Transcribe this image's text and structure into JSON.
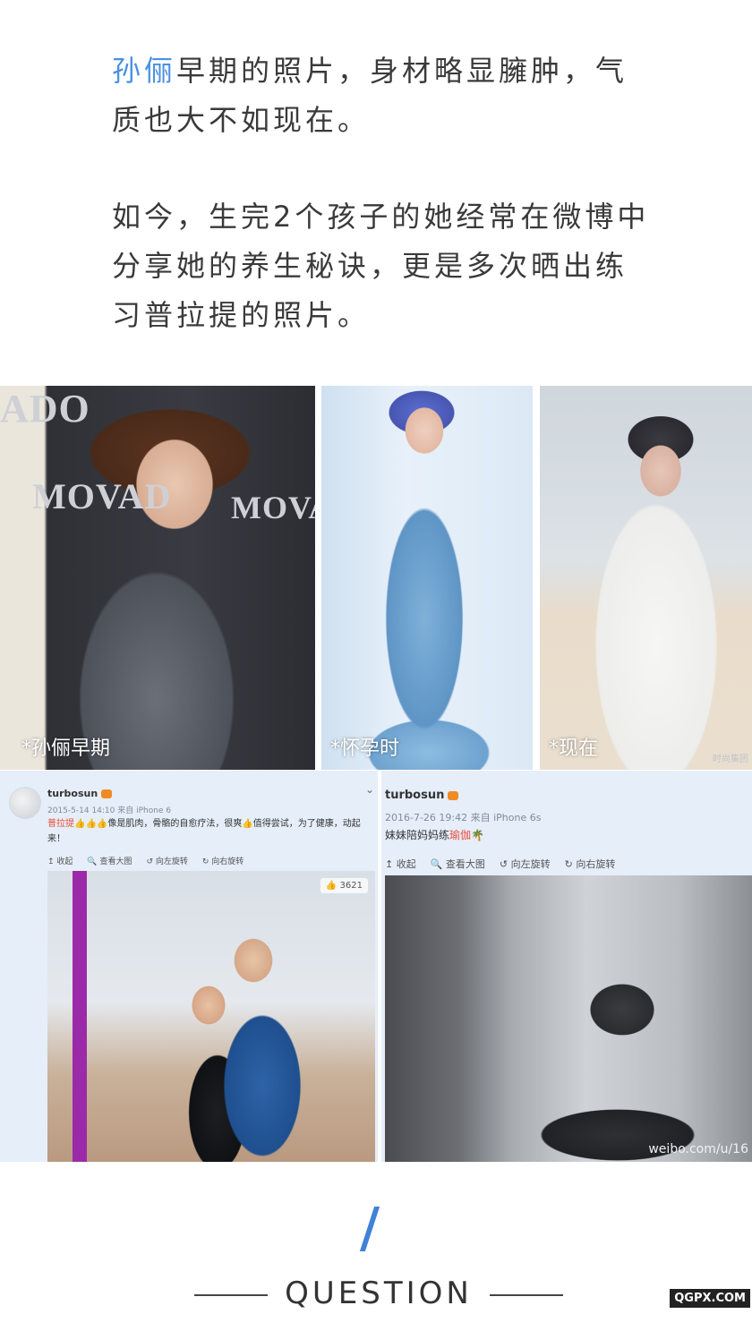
{
  "intro": {
    "name_highlight": "孙俪",
    "paragraph1_rest": "早期的照片，身材略显臃肿，气质也大不如现在。",
    "paragraph2": "如今，生完2个孩子的她经常在微博中分享她的养生秘诀，更是多次晒出练习普拉提的照片。"
  },
  "photos": [
    {
      "caption": "*孙俪早期",
      "brand_text_1": "MOVAD",
      "brand_text_2": "MOVAD",
      "brand_text_top": "ADO"
    },
    {
      "caption": "*怀孕时"
    },
    {
      "caption": "*现在",
      "watermark": "时尚集团"
    }
  ],
  "weibo_posts": [
    {
      "user": "turbosun",
      "meta": "2015-5-14 14:10 来自 iPhone 6",
      "text_highlight": "普拉提",
      "text_body": "👍👍👍像是肌肉，骨骼的自愈疗法，很爽👍值得尝试，为了健康，动起来！",
      "actions": [
        "↥ 收起",
        "🔍 查看大图",
        "↺ 向左旋转",
        "↻ 向右旋转"
      ],
      "likes": "3621"
    },
    {
      "user": "turbosun",
      "meta": "2016-7-26 19:42 来自 iPhone 6s",
      "text_body": "妹妹陪妈妈练",
      "text_highlight": "瑜伽",
      "actions": [
        "↥ 收起",
        "🔍 查看大图",
        "↺ 向左旋转",
        "↻ 向右旋转"
      ],
      "watermark": "weibo.com/u/16"
    }
  ],
  "section": {
    "title": "QUESTION",
    "accent_color": "#3f82d8"
  },
  "site_badge": "QGPX.COM"
}
